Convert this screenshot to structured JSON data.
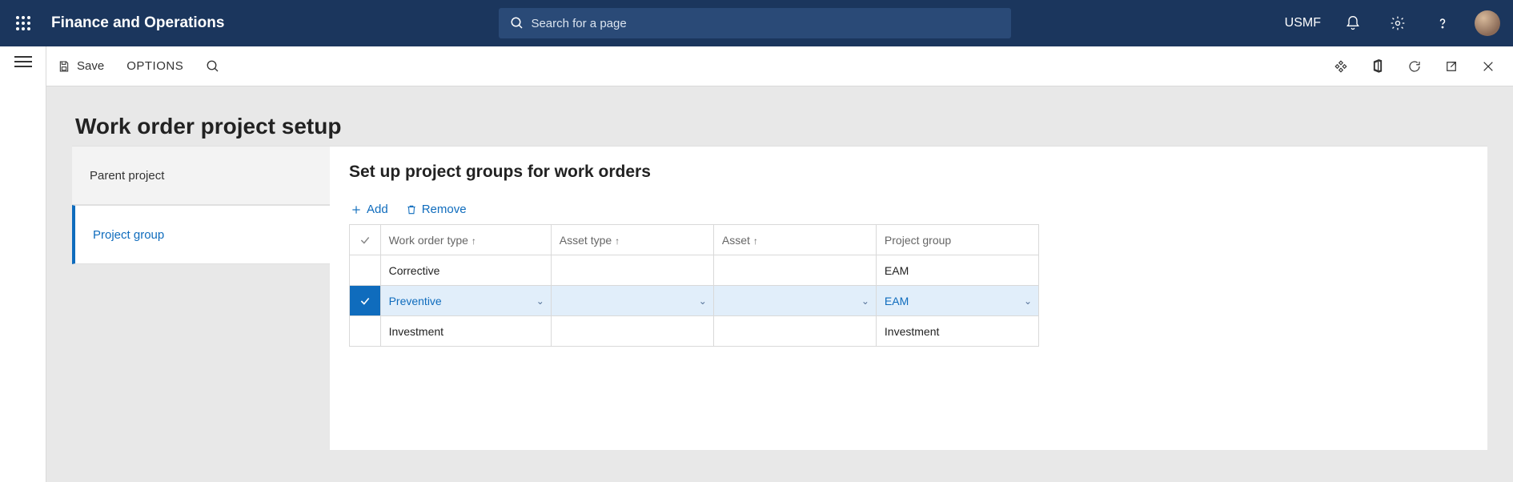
{
  "header": {
    "brand": "Finance and Operations",
    "search_placeholder": "Search for a page",
    "company": "USMF"
  },
  "commandbar": {
    "save_label": "Save",
    "options_label": "OPTIONS"
  },
  "page": {
    "title": "Work order project setup"
  },
  "sidenav": {
    "items": [
      {
        "label": "Parent project",
        "active": false
      },
      {
        "label": "Project group",
        "active": true
      }
    ]
  },
  "panel": {
    "title": "Set up project groups for work orders",
    "toolbar": {
      "add_label": "Add",
      "remove_label": "Remove"
    },
    "columns": [
      {
        "label": "Work order type",
        "sort": "asc"
      },
      {
        "label": "Asset type",
        "sort": "asc"
      },
      {
        "label": "Asset",
        "sort": "asc"
      },
      {
        "label": "Project group",
        "sort": null
      }
    ],
    "rows": [
      {
        "selected": false,
        "work_order_type": "Corrective",
        "asset_type": "",
        "asset": "",
        "project_group": "EAM"
      },
      {
        "selected": true,
        "work_order_type": "Preventive",
        "asset_type": "",
        "asset": "",
        "project_group": "EAM"
      },
      {
        "selected": false,
        "work_order_type": "Investment",
        "asset_type": "",
        "asset": "",
        "project_group": "Investment"
      }
    ]
  }
}
